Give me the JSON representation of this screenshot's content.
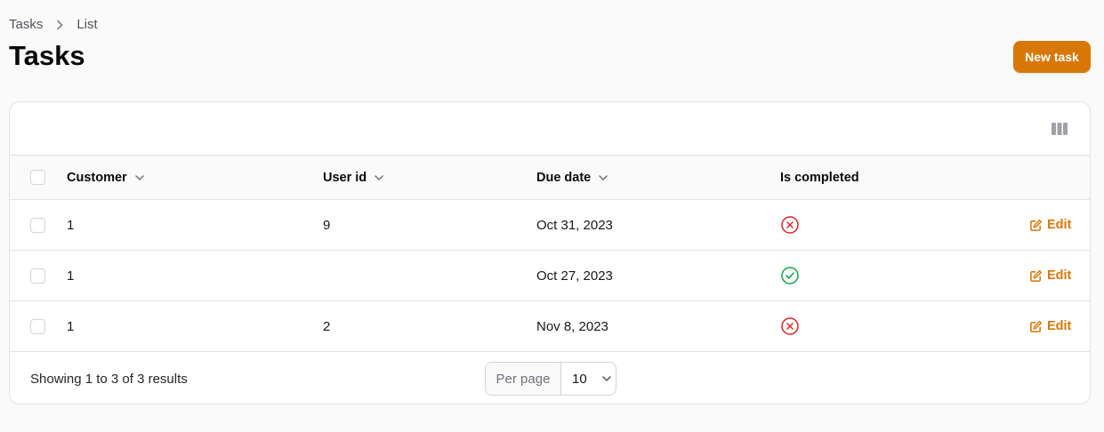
{
  "breadcrumb": {
    "items": [
      "Tasks",
      "List"
    ]
  },
  "page": {
    "title": "Tasks",
    "new_button": "New task"
  },
  "colors": {
    "accent": "#d97706",
    "success": "#16a34a",
    "danger": "#dc2626"
  },
  "table": {
    "columns": [
      {
        "label": "Customer",
        "sortable": true
      },
      {
        "label": "User id",
        "sortable": true
      },
      {
        "label": "Due date",
        "sortable": true
      },
      {
        "label": "Is completed",
        "sortable": false
      }
    ],
    "rows": [
      {
        "customer": "1",
        "user_id": "9",
        "due_date": "Oct 31, 2023",
        "is_completed": false,
        "action": "Edit"
      },
      {
        "customer": "1",
        "user_id": "",
        "due_date": "Oct 27, 2023",
        "is_completed": true,
        "action": "Edit"
      },
      {
        "customer": "1",
        "user_id": "2",
        "due_date": "Nov 8, 2023",
        "is_completed": false,
        "action": "Edit"
      }
    ]
  },
  "footer": {
    "showing": "Showing 1 to 3 of 3 results",
    "per_page_label": "Per page",
    "per_page_value": "10"
  }
}
